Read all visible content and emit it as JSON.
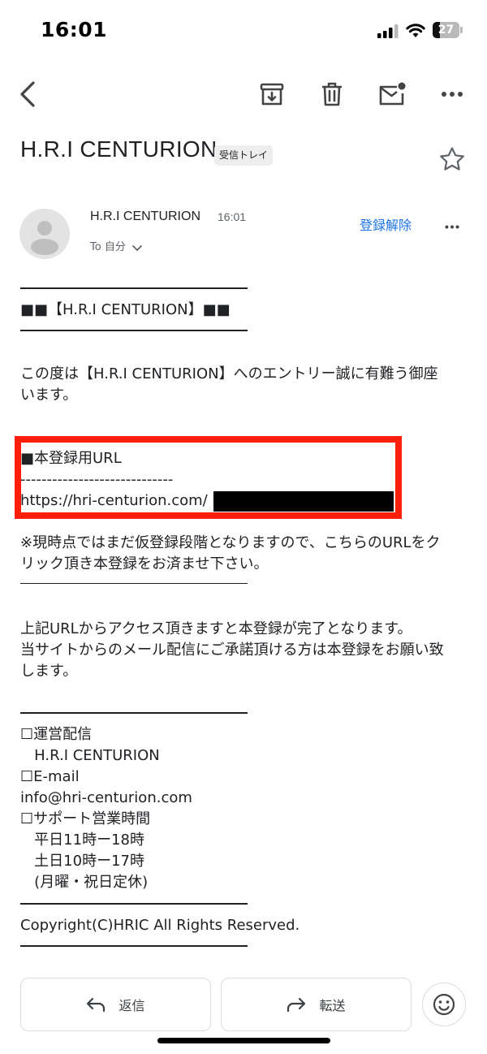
{
  "status_bar": {
    "time": "16:01",
    "battery": "27"
  },
  "email": {
    "subject": "H.R.I CENTURION",
    "label": "受信トレイ",
    "sender_name": "H.R.I CENTURION",
    "sent_time": "16:01",
    "recipient": "To 自分",
    "unsubscribe": "登録解除"
  },
  "body": {
    "header_line": "■■【H.R.I CENTURION】■■",
    "intro": "この度は【H.R.I CENTURION】へのエントリー誠に有難う御座\nいます。",
    "url_heading": "■本登録用URL",
    "url_dashes": "-----------------------------",
    "url": "https://hri-centurion.com/",
    "notice": "※現時点ではまだ仮登録段階となりますので、こちらのURLをク\nリック頂き本登録をお済ませ下さい。",
    "completion": "上記URLからアクセス頂きますと本登録が完了となります。\n当サイトからのメール配信にご承諾頂ける方は本登録をお願い致\nします。",
    "contact": "☐運営配信\n   H.R.I CENTURION\n☐E-mail\ninfo@hri-centurion.com\n☐サポート営業時間\n   平日11時ー18時\n   土日10時ー17時\n   (月曜・祝日定休)",
    "copyright": "Copyright(C)HRIC All Rights Reserved."
  },
  "actions": {
    "reply": "返信",
    "forward": "転送"
  }
}
